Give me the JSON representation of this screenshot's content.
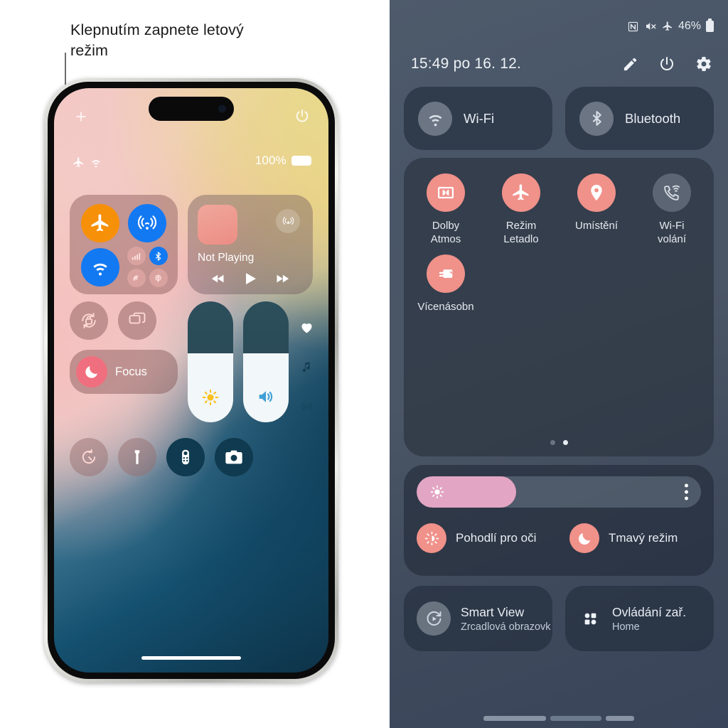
{
  "callout": {
    "text": "Klepnutím zapnete letový režim"
  },
  "iphone": {
    "status": {
      "airplane_icon": "airplane-icon",
      "wifi_icon": "wifi-icon"
    },
    "battery": {
      "percent": "100%",
      "icon": "battery-icon"
    },
    "top_icons": {
      "add": "plus-icon",
      "power": "power-icon"
    },
    "connectivity": {
      "airplane": {
        "name": "airplane-mode-button",
        "state": "on",
        "color": "#f79009"
      },
      "airdrop": {
        "name": "airdrop-button",
        "state": "on",
        "color": "#1279f2"
      },
      "wifi": {
        "name": "wifi-button",
        "state": "on",
        "color": "#1279f2"
      },
      "cellular": {
        "name": "cellular-button",
        "state": "off"
      },
      "bluetooth": {
        "name": "bluetooth-button",
        "state": "on",
        "color": "#1279f2"
      },
      "hotspot": {
        "name": "personal-hotspot-button",
        "state": "off"
      },
      "satellite": {
        "name": "satellite-button",
        "state": "off"
      }
    },
    "media": {
      "title": "Not Playing",
      "airplay_icon": "airplay-icon",
      "prev_icon": "rewind-icon",
      "play_icon": "play-icon",
      "next_icon": "fast-forward-icon"
    },
    "controls": {
      "rotation_lock": "rotation-lock-icon",
      "screen_mirroring": "screen-mirroring-icon",
      "focus_label": "Focus",
      "focus_icon": "moon-icon",
      "timer": "timer-icon",
      "flashlight": "flashlight-icon",
      "remote": "apple-tv-remote-icon",
      "camera": "camera-icon"
    },
    "sliders": {
      "brightness": {
        "name": "brightness-slider",
        "value": 57,
        "icon": "sun-icon"
      },
      "volume": {
        "name": "volume-slider",
        "value": 57,
        "icon": "speaker-icon"
      }
    },
    "side_icons": [
      "heart-icon",
      "music-note-icon",
      "connectivity-icon"
    ]
  },
  "android": {
    "statusbar": {
      "nfc_icon": "nfc-icon",
      "mute_icon": "mute-icon",
      "airplane_icon": "airplane-icon",
      "battery_percent": "46%",
      "battery_icon": "battery-icon"
    },
    "header": {
      "clock": "15:49  po 16. 12.",
      "edit_icon": "pencil-icon",
      "power_icon": "power-icon",
      "settings_icon": "gear-icon"
    },
    "top_tiles": [
      {
        "label": "Wi-Fi",
        "icon": "wifi-icon",
        "state": "off"
      },
      {
        "label": "Bluetooth",
        "icon": "bluetooth-icon",
        "state": "off"
      }
    ],
    "quick_tiles": [
      {
        "label": "Dolby\nAtmos",
        "icon": "dolby-icon",
        "state": "on"
      },
      {
        "label": "Režim\nLetadlo",
        "icon": "airplane-icon",
        "state": "on"
      },
      {
        "label": "Umístění",
        "icon": "location-pin-icon",
        "state": "on"
      },
      {
        "label": "Wi-Fi\nvolání",
        "icon": "wifi-calling-icon",
        "state": "off"
      },
      {
        "label": "Vícenásobn",
        "icon": "multi-window-icon",
        "state": "on"
      }
    ],
    "pages": {
      "count": 2,
      "active": 2
    },
    "brightness": {
      "name": "brightness-slider",
      "value": 35,
      "sun_icon": "sun-icon",
      "menu_icon": "kebab-menu-icon"
    },
    "brightness_toggles": [
      {
        "label": "Pohodlí pro oči",
        "icon": "eye-comfort-icon",
        "state": "on"
      },
      {
        "label": "Tmavý režim",
        "icon": "moon-icon",
        "state": "on"
      }
    ],
    "bottom_tiles": [
      {
        "title": "Smart View",
        "subtitle": "Zrcadlová obrazovk",
        "icon": "smart-view-icon"
      },
      {
        "title": "Ovládání zař.",
        "subtitle": "Home",
        "icon": "device-control-icon"
      }
    ],
    "colors": {
      "accent_on": "#f0918a",
      "slider_fill": "#e3a5c4",
      "panel": "#28303c"
    }
  }
}
